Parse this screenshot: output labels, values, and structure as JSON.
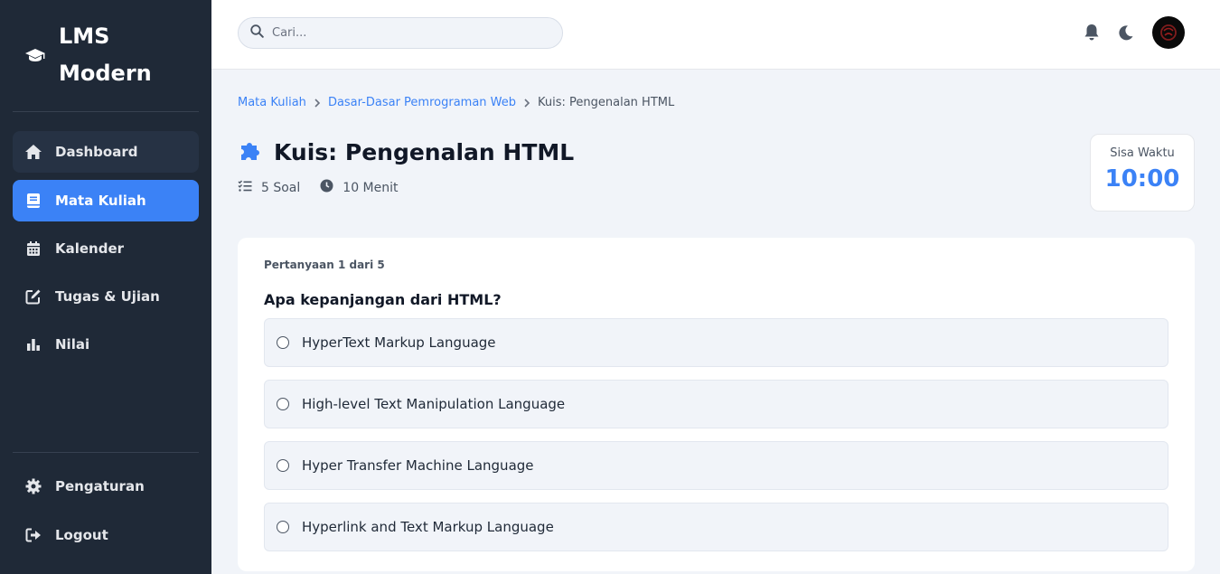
{
  "brand": {
    "name": "LMS Modern",
    "icon": "graduation-cap-icon"
  },
  "sidebar": {
    "items": [
      {
        "label": "Dashboard",
        "icon": "home-icon"
      },
      {
        "label": "Mata Kuliah",
        "icon": "book-icon",
        "active": true
      },
      {
        "label": "Kalender",
        "icon": "calendar-icon"
      },
      {
        "label": "Tugas & Ujian",
        "icon": "edit-icon"
      },
      {
        "label": "Nilai",
        "icon": "bar-chart-icon"
      }
    ],
    "bottom": [
      {
        "label": "Pengaturan",
        "icon": "gear-icon"
      },
      {
        "label": "Logout",
        "icon": "logout-icon"
      }
    ]
  },
  "search": {
    "placeholder": "Cari...",
    "value": ""
  },
  "breadcrumb": {
    "items": [
      "Mata Kuliah",
      "Dasar-Dasar Pemrograman Web"
    ],
    "current": "Kuis: Pengenalan HTML"
  },
  "quiz": {
    "title": "Kuis: Pengenalan HTML",
    "soal": "5 Soal",
    "durasi": "10 Menit",
    "timer_label": "Sisa Waktu",
    "timer_value": "10:00"
  },
  "question": {
    "counter": "Pertanyaan 1 dari 5",
    "text": "Apa kepanjangan dari HTML?",
    "options": [
      "HyperText Markup Language",
      "High-level Text Manipulation Language",
      "Hyper Transfer Machine Language",
      "Hyperlink and Text Markup Language"
    ]
  },
  "colors": {
    "sidebar": "#1f2937",
    "accent": "#3b82f6",
    "background": "#f1f4f9"
  }
}
